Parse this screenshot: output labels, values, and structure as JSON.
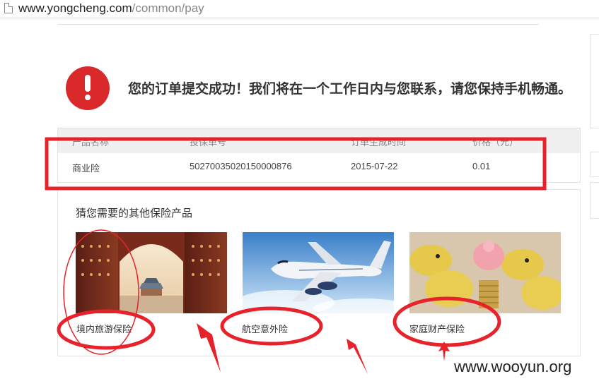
{
  "browser": {
    "url_domain": "www.yongcheng.com",
    "url_path": "/common/pay"
  },
  "success": {
    "message": "您的订单提交成功！我们将在一个工作日内与您联系，请您保持手机畅通。"
  },
  "order_table": {
    "headers": [
      "产品名称",
      "投保单号",
      "订单生成时间",
      "价格（元）"
    ],
    "row": [
      "商业险",
      "50270035020150000876",
      "2015-07-22",
      "0.01"
    ]
  },
  "recommendations": {
    "title": "猜您需要的其他保险产品",
    "items": [
      {
        "label": "境内旅游保险",
        "image": "travel-gate-image"
      },
      {
        "label": "航空意外险",
        "image": "airplane-image"
      },
      {
        "label": "家庭财产保险",
        "image": "piggy-bank-image"
      }
    ]
  },
  "annotation_color": "#e8222a",
  "watermark": "www.wooyun.org"
}
